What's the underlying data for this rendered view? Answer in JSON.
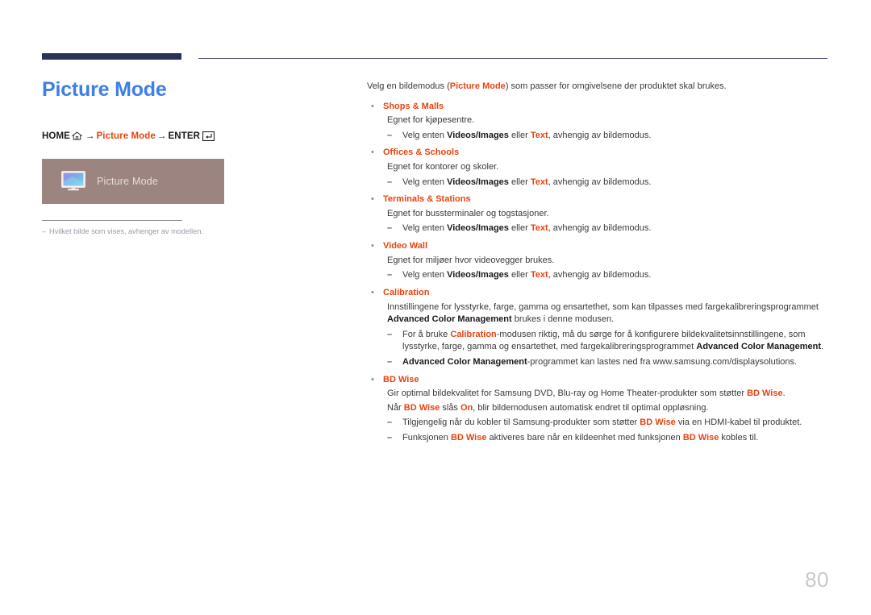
{
  "document": {
    "page_number": "80",
    "title": "Picture Mode"
  },
  "colors": {
    "title_blue": "#3d7fe8",
    "accent_red": "#e8430f",
    "rule_navy": "#2b3354",
    "menu_box_bg": "#9c8480",
    "body_text": "#3a3a3a",
    "note_gray": "#9a9aa6",
    "page_number_gray": "#c8c8cf"
  },
  "breadcrumb": {
    "home_label": "HOME",
    "home_icon": "home-icon",
    "arrow1": "→",
    "menu_label": "Picture Mode",
    "arrow2": "→",
    "enter_label": "ENTER",
    "enter_icon": "enter-key-icon"
  },
  "menu_preview": {
    "icon": "monitor-icon",
    "label": "Picture Mode"
  },
  "note": {
    "dash": "–",
    "text": "Hvilket bilde som vises, avhenger av modellen."
  },
  "content": {
    "intro_part1": "Velg en bildemodus (",
    "intro_bold": "Picture Mode",
    "intro_part2": ") som passer for omgivelsene der produktet skal brukes.",
    "bullet_glyph": "•",
    "dash_glyph": "–",
    "items": [
      {
        "title": "Shops & Malls",
        "body": "Egnet for kjøpesentre.",
        "sub": [
          {
            "p1": "Velg enten ",
            "b1": "Videos/Images",
            "p2": " eller ",
            "b2": "Text",
            "p3": ", avhengig av bildemodus."
          }
        ]
      },
      {
        "title": "Offices & Schools",
        "body": "Egnet for kontorer og skoler.",
        "sub": [
          {
            "p1": "Velg enten ",
            "b1": "Videos/Images",
            "p2": " eller ",
            "b2": "Text",
            "p3": ", avhengig av bildemodus."
          }
        ]
      },
      {
        "title": "Terminals & Stations",
        "body": "Egnet for bussterminaler og togstasjoner.",
        "sub": [
          {
            "p1": "Velg enten ",
            "b1": "Videos/Images",
            "p2": " eller ",
            "b2": "Text",
            "p3": ", avhengig av bildemodus."
          }
        ]
      },
      {
        "title": "Video Wall",
        "body": "Egnet for miljøer hvor videovegger brukes.",
        "sub": [
          {
            "p1": "Velg enten ",
            "b1": "Videos/Images",
            "p2": " eller ",
            "b2": "Text",
            "p3": ", avhengig av bildemodus."
          }
        ]
      }
    ],
    "calibration": {
      "title": "Calibration",
      "body_p1": "Innstillingene for lysstyrke, farge, gamma og ensartethet, som kan tilpasses med fargekalibreringsprogrammet ",
      "body_b1": "Advanced Color Management",
      "body_p2": " brukes i denne modusen.",
      "sub1_p1": "For å bruke ",
      "sub1_r1": "Calibration",
      "sub1_p2": "-modusen riktig, må du sørge for å konfigurere bildekvalitetsinnstillingene, som lysstyrke, farge, gamma og ensartethet, med fargekalibreringsprogrammet ",
      "sub1_b1": "Advanced Color Management",
      "sub1_p3": ".",
      "sub2_b1": "Advanced Color Management",
      "sub2_p1": "-programmet kan lastes ned fra www.samsung.com/displaysolutions."
    },
    "bdwise": {
      "title": "BD Wise",
      "body1_p1": "Gir optimal bildekvalitet for Samsung DVD, Blu-ray og Home Theater-produkter som støtter ",
      "body1_r1": "BD Wise",
      "body1_p2": ".",
      "body2_p1": "Når ",
      "body2_r1": "BD Wise",
      "body2_p2": " slås ",
      "body2_r2": "On",
      "body2_p3": ", blir bildemodusen automatisk endret til optimal oppløsning.",
      "sub1_p1": "Tilgjengelig når du kobler til Samsung-produkter som støtter ",
      "sub1_r1": "BD Wise",
      "sub1_p2": " via en HDMI-kabel til produktet.",
      "sub2_p1": "Funksjonen ",
      "sub2_r1": "BD Wise",
      "sub2_p2": " aktiveres bare når en kildeenhet med funksjonen ",
      "sub2_r2": "BD Wise",
      "sub2_p3": " kobles til."
    }
  }
}
